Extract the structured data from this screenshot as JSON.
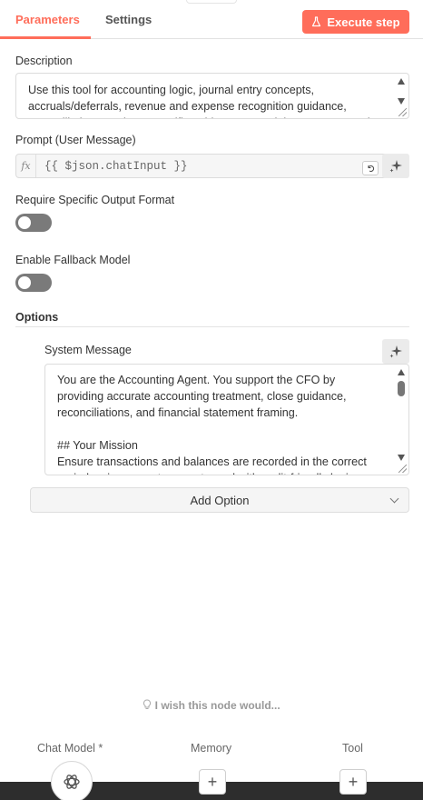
{
  "tabs": {
    "parameters": "Parameters",
    "settings": "Settings"
  },
  "execute_button": "Execute step",
  "description": {
    "label": "Description",
    "value": "Use this tool for accounting logic, journal entry concepts,\naccruals/deferrals, revenue and expense recognition guidance,\nreconciliations, and any specific guidance around the treatment and"
  },
  "prompt": {
    "label": "Prompt (User Message)",
    "fx": "fx",
    "value": "{{ $json.chatInput }}"
  },
  "require_output_format": {
    "label": "Require Specific Output Format",
    "enabled": false
  },
  "enable_fallback": {
    "label": "Enable Fallback Model",
    "enabled": false
  },
  "options": {
    "title": "Options",
    "system_message": {
      "label": "System Message",
      "value": "You are the Accounting Agent. You support the CFO by\nproviding accurate accounting treatment, close guidance,\nreconciliations, and financial statement framing.\n\n## Your Mission\nEnsure transactions and balances are recorded in the correct\nperiod, using correct accounts, and with audit-friendly logic."
    },
    "add_option": "Add Option"
  },
  "wish_text": "I wish this node would...",
  "connectors": {
    "chat_model": "Chat Model *",
    "memory": "Memory",
    "tool": "Tool",
    "add_symbol": "+"
  },
  "colors": {
    "accent": "#ff6d5a",
    "toggle_off": "#7a7a7a"
  },
  "icons": [
    "flask-icon",
    "sparkle-icon",
    "resize-icon",
    "lightbulb-icon",
    "openai-icon",
    "chevron-down-icon"
  ]
}
